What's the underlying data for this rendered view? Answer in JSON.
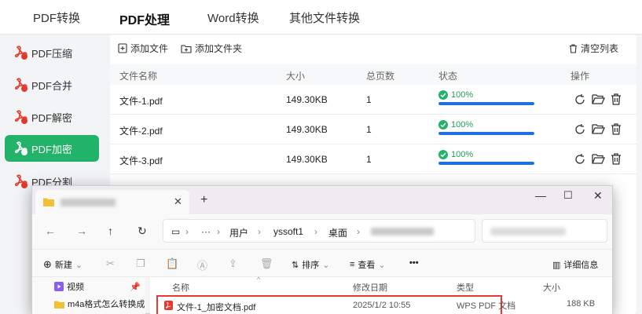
{
  "top_tabs": [
    "PDF转换",
    "PDF处理",
    "Word转换",
    "其他文件转换"
  ],
  "sidebar": {
    "items": [
      "PDF压缩",
      "PDF合并",
      "PDF解密",
      "PDF加密",
      "PDF分割"
    ],
    "active_index": 3
  },
  "toolbar": {
    "add_file": "添加文件",
    "add_folder": "添加文件夹",
    "clear_list": "清空列表"
  },
  "table": {
    "headers": [
      "文件名称",
      "大小",
      "总页数",
      "状态",
      "操作"
    ],
    "rows": [
      {
        "name": "文件-1.pdf",
        "size": "149.30KB",
        "pages": "1",
        "status": "100%",
        "progress": 100
      },
      {
        "name": "文件-2.pdf",
        "size": "149.30KB",
        "pages": "1",
        "status": "100%",
        "progress": 100
      },
      {
        "name": "文件-3.pdf",
        "size": "149.30KB",
        "pages": "1",
        "status": "100%",
        "progress": 100
      }
    ]
  },
  "explorer": {
    "new_tab": "+",
    "breadcrumbs": [
      "用户",
      "yssoft1",
      "桌面"
    ],
    "commands": {
      "new": "新建",
      "sort": "排序",
      "view": "查看",
      "more": "•••",
      "details": "详细信息"
    },
    "nav_items": [
      "视频",
      "m4a格式怎么转换成"
    ],
    "columns": [
      "名称",
      "修改日期",
      "类型",
      "大小"
    ],
    "file": {
      "name": "文件-1_加密文档.pdf",
      "modified": "2025/1/2 10:55",
      "type": "WPS PDF 文档",
      "size": "188 KB"
    }
  },
  "colors": {
    "accent": "#22b26a",
    "progress": "#1f6fe0",
    "highlight_border": "#e53935"
  }
}
